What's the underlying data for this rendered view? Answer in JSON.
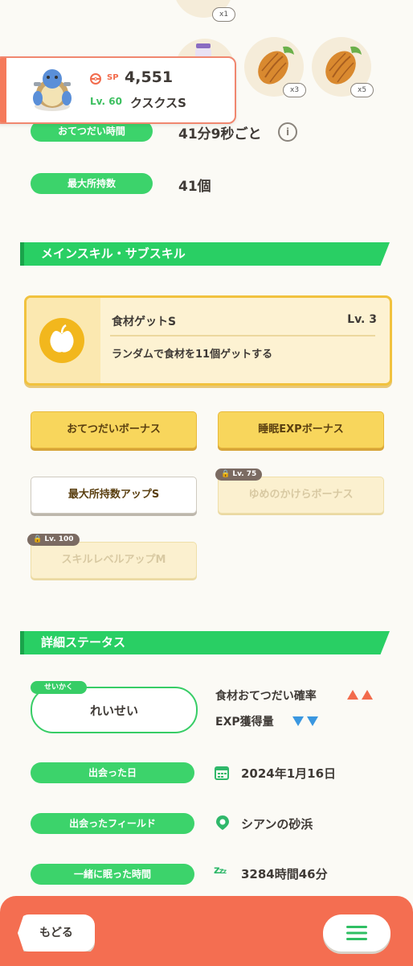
{
  "ingredients": [
    {
      "icon": "ingredient-icon",
      "count": "x1"
    },
    {
      "icon": "jar-icon",
      "count": ""
    },
    {
      "icon": "cacao-icon",
      "count": "x3"
    },
    {
      "icon": "cacao-icon",
      "count": "x5"
    }
  ],
  "pokemon": {
    "sp_label": "SP",
    "sp_value": "4,551",
    "level": "Lv. 60",
    "name": "クスクスS"
  },
  "help_interval": {
    "label": "おてつだい時間",
    "value": "41分9秒ごと"
  },
  "max_carry": {
    "label": "最大所持数",
    "value": "41個"
  },
  "skills_section": {
    "title": "メインスキル・サブスキル",
    "main_skill": {
      "name": "食材ゲットS",
      "level": "Lv. 3",
      "description": "ランダムで食材を11個ゲットする"
    },
    "sub_skills": [
      {
        "label": "おてつだいボーナス",
        "locked": false,
        "lock_level": ""
      },
      {
        "label": "睡眠EXPボーナス",
        "locked": false,
        "lock_level": ""
      },
      {
        "label": "最大所持数アップS",
        "locked": false,
        "lock_level": ""
      },
      {
        "label": "ゆめのかけらボーナス",
        "locked": true,
        "lock_level": "Lv. 75"
      },
      {
        "label": "スキルレベルアップM",
        "locked": true,
        "lock_level": "Lv. 100"
      }
    ]
  },
  "details_section": {
    "title": "詳細ステータス",
    "nature_tag": "せいかく",
    "nature": "れいせい",
    "nature_up": "食材おてつだい確率",
    "nature_down": "EXP獲得量",
    "met_date": {
      "label": "出会った日",
      "value": "2024年1月16日"
    },
    "met_field": {
      "label": "出会ったフィールド",
      "value": "シアンの砂浜"
    },
    "slept_time": {
      "label": "一緒に眠った時間",
      "value": "3284時間46分"
    }
  },
  "footer": {
    "back_label": "もどる"
  },
  "colors": {
    "green": "#3cd36b",
    "coral": "#f46e51",
    "gold": "#f8d65c",
    "up_arrow": "#f26b4c",
    "down_arrow": "#3a97e0"
  }
}
